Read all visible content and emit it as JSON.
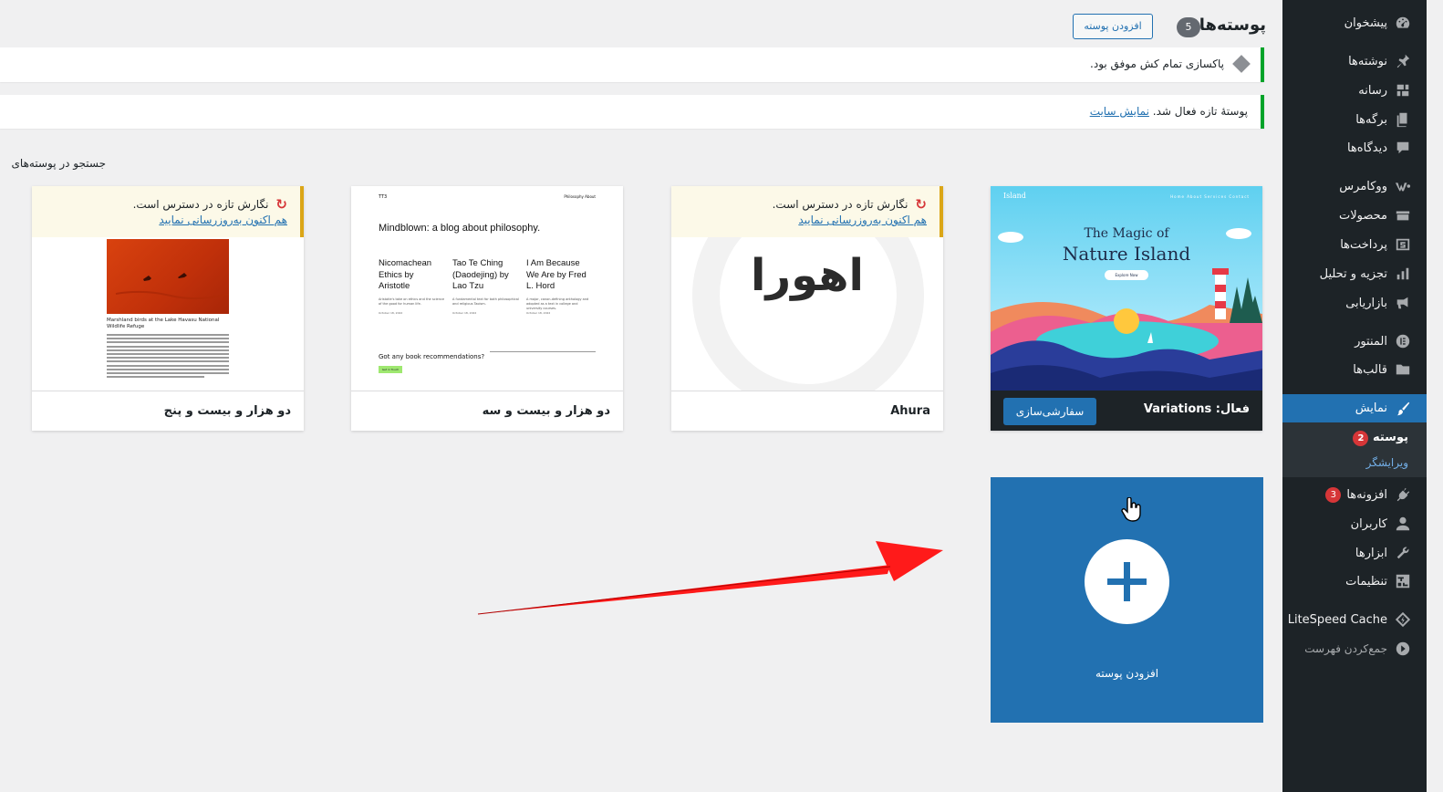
{
  "sidebar": {
    "items": [
      {
        "label": "پیشخوان",
        "icon": "dashboard-icon"
      },
      {
        "label": "نوشته‌ها",
        "icon": "pin-icon"
      },
      {
        "label": "رسانه",
        "icon": "media-icon"
      },
      {
        "label": "برگه‌ها",
        "icon": "pages-icon"
      },
      {
        "label": "دیدگاه‌ها",
        "icon": "comments-icon"
      },
      {
        "label": "ووکامرس",
        "icon": "woocommerce-icon"
      },
      {
        "label": "محصولات",
        "icon": "products-icon"
      },
      {
        "label": "پرداخت‌ها",
        "icon": "payments-icon"
      },
      {
        "label": "تجزیه و تحلیل",
        "icon": "analytics-icon"
      },
      {
        "label": "بازاریابی",
        "icon": "megaphone-icon"
      },
      {
        "label": "المنتور",
        "icon": "elementor-icon"
      },
      {
        "label": "قالب‌ها",
        "icon": "folder-icon"
      },
      {
        "label": "نمایش",
        "icon": "brush-icon"
      },
      {
        "label": "افزونه‌ها",
        "icon": "plugins-icon",
        "badge": "3"
      },
      {
        "label": "کاربران",
        "icon": "users-icon"
      },
      {
        "label": "ابزارها",
        "icon": "wrench-icon"
      },
      {
        "label": "تنظیمات",
        "icon": "settings-icon"
      },
      {
        "label": "LiteSpeed Cache",
        "icon": "litespeed-icon"
      },
      {
        "label": "جمع‌کردن فهرست",
        "icon": "collapse-icon"
      }
    ],
    "submenu": {
      "current": "پوسته",
      "current_badge": "2",
      "editor": "ویرایشگر"
    }
  },
  "header": {
    "title": "پوسته‌ها",
    "count": "5",
    "add_button": "افزودن پوسته"
  },
  "notices": {
    "cleanup": "پاکسازی تمام کش موفق بود.",
    "activated_text": "پوستهٔ تازه فعال شد.",
    "activated_link": "نمایش سایت"
  },
  "search_label": "جستجو در پوسته‌های",
  "themes": {
    "active": {
      "name": "فعال: Variations",
      "customize": "سفارشی‌سازی",
      "shot": {
        "brand": "Island",
        "nav": "Home   About   Services   Contact",
        "title_line1": "The Magic of",
        "title_line2": "Nature Island",
        "button": "Explore Now"
      }
    },
    "ahura": {
      "name": "Ahura",
      "logo": "اهورا",
      "update_line1": "نگارش تازه در دسترس است.",
      "update_line2": "هم اکنون به‌روزرسانی نمایید"
    },
    "tt3": {
      "name": "دو هزار و بیست و سه",
      "shot": {
        "top_left": "TT3",
        "top_right": "Philosophy   About",
        "heading": "Mindblown: a blog about philosophy.",
        "col1": "Nicomachean Ethics by Aristotle",
        "col2": "Tao Te Ching (Daodejing) by Lao Tzu",
        "col3": "I Am Because We Are by Fred L. Hord",
        "small1": "Aristotle's take on ethics and the science of the good for human life.",
        "small2": "A fundamental text for both philosophical and religious Taoism.",
        "small3": "A major, canon-defining anthology and adopted as a text in college and university courses.",
        "date": "October 18, 2022",
        "question": "Got any book recommendations?",
        "button": "Get in Touch"
      }
    },
    "tt5": {
      "name": "دو هزار و بیست و پنج",
      "update_line1": "نگارش تازه در دسترس است.",
      "update_line2": "هم اکنون به‌روزرسانی نمایید",
      "shot": {
        "caption": "Marshland birds at the Lake Havasu National Wildlife Refuge"
      }
    }
  },
  "add_new": {
    "label": "افزودن پوسته"
  },
  "colors": {
    "admin_bg": "#1d2327",
    "accent": "#2271b1",
    "success": "#00a32a",
    "warning": "#dba617",
    "badge": "#d63638",
    "annotation_arrow": "#ff1a1a"
  }
}
